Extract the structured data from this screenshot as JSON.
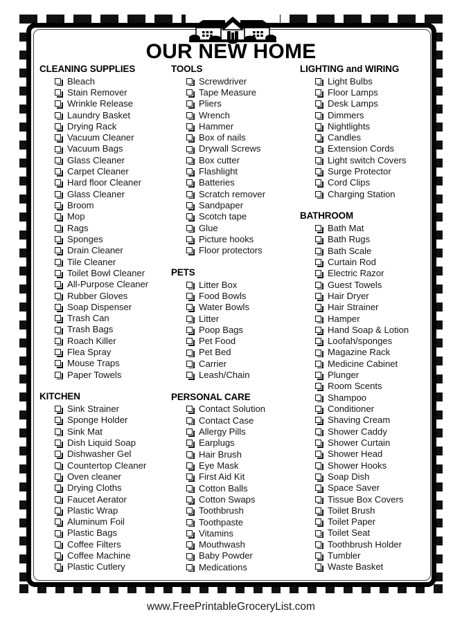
{
  "document": {
    "title": "OUR NEW HOME",
    "footer": "www.FreePrintableGroceryList.com"
  },
  "columns": [
    {
      "sections": [
        {
          "heading": "CLEANING SUPPLIES",
          "items": [
            "Bleach",
            "Stain Remover",
            "Wrinkle Release",
            "Laundry Basket",
            "Drying Rack",
            "Vacuum Cleaner",
            "Vacuum Bags",
            "Glass Cleaner",
            "Carpet Cleaner",
            "Hard floor Cleaner",
            "Glass Cleaner",
            "Broom",
            "Mop",
            "Rags",
            "Sponges",
            "Drain Cleaner",
            "Tile Cleaner",
            "Toilet Bowl Cleaner",
            "All-Purpose Cleaner",
            "Rubber Gloves",
            "Soap Dispenser",
            "Trash Can",
            "Trash Bags",
            "Roach Killer",
            "Flea Spray",
            "Mouse Traps",
            "Paper Towels"
          ]
        },
        {
          "heading": "KITCHEN",
          "items": [
            "Sink Strainer",
            "Sponge Holder",
            "Sink Mat",
            "Dish Liquid Soap",
            "Dishwasher Gel",
            "Countertop Cleaner",
            "Oven cleaner",
            "Drying Cloths",
            "Faucet Aerator",
            "Plastic Wrap",
            "Aluminum Foil",
            "Plastic Bags",
            "Coffee Filters",
            "Coffee Machine",
            "Plastic Cutlery"
          ]
        }
      ]
    },
    {
      "sections": [
        {
          "heading": "TOOLS",
          "items": [
            "Screwdriver",
            "Tape Measure",
            "Pliers",
            "Wrench",
            "Hammer",
            "Box of nails",
            "Drywall Screws",
            "Box cutter",
            "Flashlight",
            "Batteries",
            "Scratch remover",
            "Sandpaper",
            "Scotch tape",
            "Glue",
            "Picture hooks",
            "Floor protectors"
          ]
        },
        {
          "heading": "PETS",
          "items": [
            "Litter Box",
            "Food Bowls",
            "Water Bowls",
            "Litter",
            "Poop Bags",
            "Pet Food",
            "Pet Bed",
            "Carrier",
            "Leash/Chain"
          ]
        },
        {
          "heading": "PERSONAL CARE",
          "items": [
            "Contact Solution",
            "Contact Case",
            "Allergy Pills",
            "Earplugs",
            "Hair Brush",
            "Eye Mask",
            "First Aid Kit",
            "Cotton Balls",
            "Cotton Swaps",
            "Toothbrush",
            "Toothpaste",
            "Vitamins",
            "Mouthwash",
            "Baby Powder",
            "Medications"
          ]
        }
      ]
    },
    {
      "sections": [
        {
          "heading": "LIGHTING and WIRING",
          "items": [
            "Light Bulbs",
            "Floor Lamps",
            "Desk Lamps",
            "Dimmers",
            "Nightlights",
            "Candles",
            "Extension Cords",
            "Light switch Covers",
            "Surge Protector",
            "Cord Clips",
            "Charging Station"
          ]
        },
        {
          "heading": "BATHROOM",
          "items": [
            "Bath Mat",
            "Bath Rugs",
            "Bath Scale",
            "Curtain Rod",
            "Electric Razor",
            "Guest Towels",
            "Hair Dryer",
            "Hair Strainer",
            "Hamper",
            "Hand Soap & Lotion",
            "Loofah/sponges",
            "Magazine Rack",
            "Medicine Cabinet",
            "Plunger",
            "Room Scents",
            "Shampoo",
            "Conditioner",
            "Shaving Cream",
            "Shower Caddy",
            "Shower Curtain",
            "Shower Head",
            "Shower Hooks",
            "Soap Dish",
            "Space Saver",
            "Tissue Box Covers",
            "Toilet Brush",
            "Toilet Paper",
            "Toilet Seat",
            "Toothbrush Holder",
            "Tumbler",
            "Waste Basket"
          ]
        }
      ]
    }
  ],
  "graphics": {
    "house_icon": "house-illustration",
    "checkbox_icon": "empty-checkbox"
  },
  "colors": {
    "ink": "#000000",
    "text": "#141414",
    "paper": "#ffffff"
  }
}
